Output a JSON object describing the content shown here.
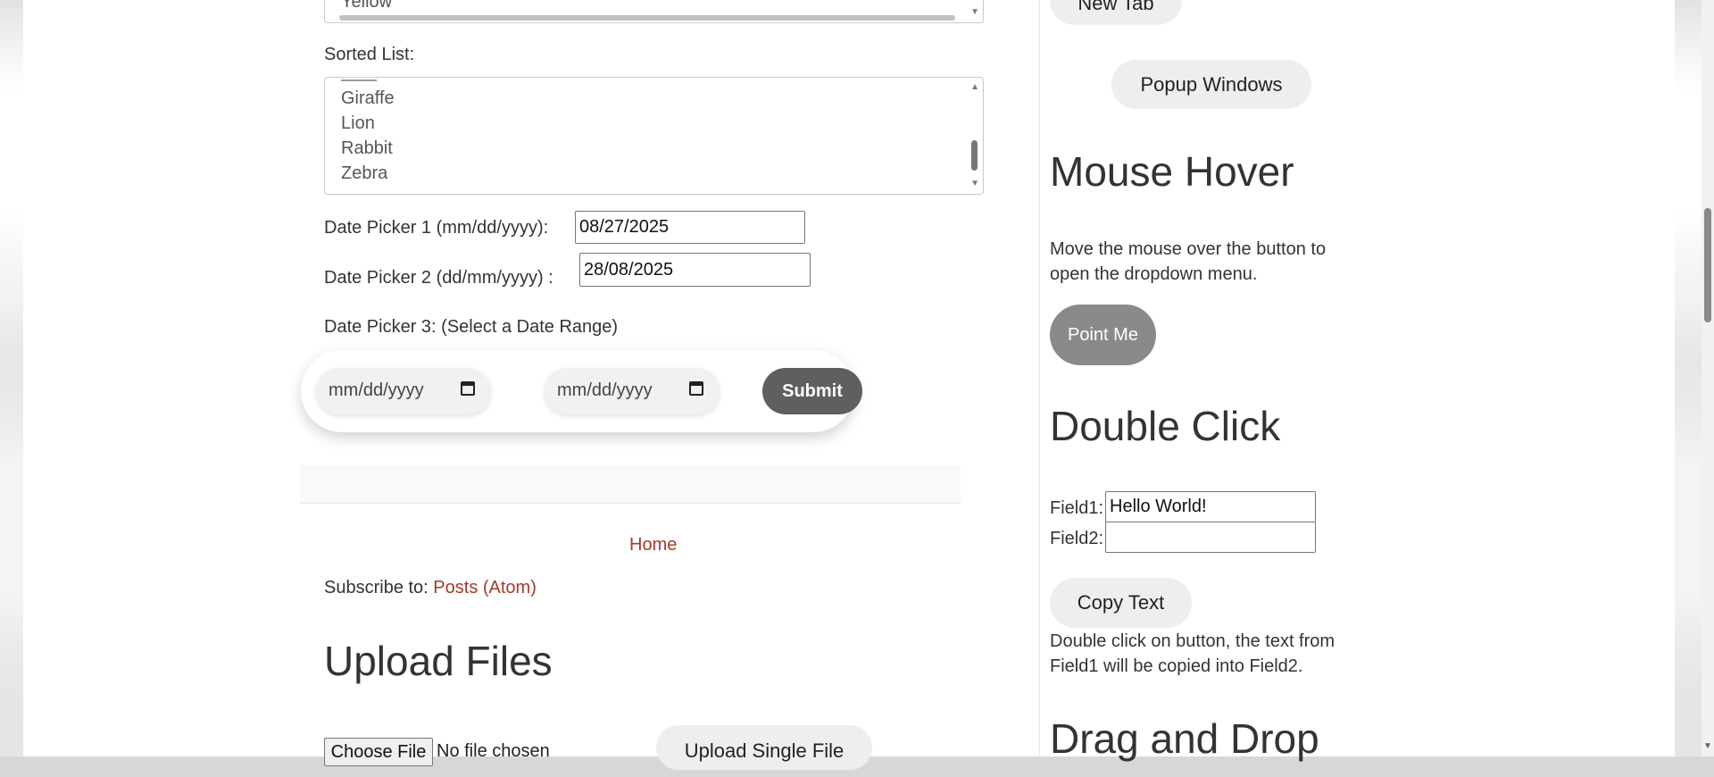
{
  "left": {
    "colors_listbox": {
      "partial_top_item": "Yellow"
    },
    "sorted_list": {
      "label": "Sorted List:",
      "items": [
        "Giraffe",
        "Lion",
        "Rabbit",
        "Zebra"
      ]
    },
    "date_picker_1": {
      "label": "Date Picker 1 (mm/dd/yyyy):",
      "value": "08/27/2025"
    },
    "date_picker_2": {
      "label": "Date Picker 2 (dd/mm/yyyy) :",
      "value": "28/08/2025"
    },
    "date_picker_3": {
      "label": "Date Picker 3: (Select a Date Range)",
      "start_placeholder": "mm/dd/yyyy",
      "end_placeholder": "mm/dd/yyyy",
      "submit_label": "Submit"
    },
    "nav": {
      "home_label": "Home"
    },
    "subscribe": {
      "prefix": "Subscribe to: ",
      "link": "Posts (Atom)"
    },
    "upload": {
      "heading": "Upload Files",
      "choose_file_label": "Choose File",
      "file_status": "No file chosen",
      "upload_single_label": "Upload Single File"
    }
  },
  "right": {
    "new_tab_label": "New Tab",
    "popup_windows_label": "Popup Windows",
    "mouse_hover": {
      "heading": "Mouse Hover",
      "description_line1": "Move the mouse over the button to",
      "description_line2": "open the dropdown menu.",
      "button_label": "Point Me"
    },
    "double_click": {
      "heading": "Double Click",
      "field1_label": "Field1:",
      "field1_value": "Hello World!",
      "field2_label": "Field2:",
      "field2_value": "",
      "copy_button_label": "Copy Text",
      "description_line1": "Double click on button, the text from",
      "description_line2": "Field1 will be copied into Field2."
    },
    "drag_drop": {
      "heading": "Drag and Drop"
    }
  }
}
